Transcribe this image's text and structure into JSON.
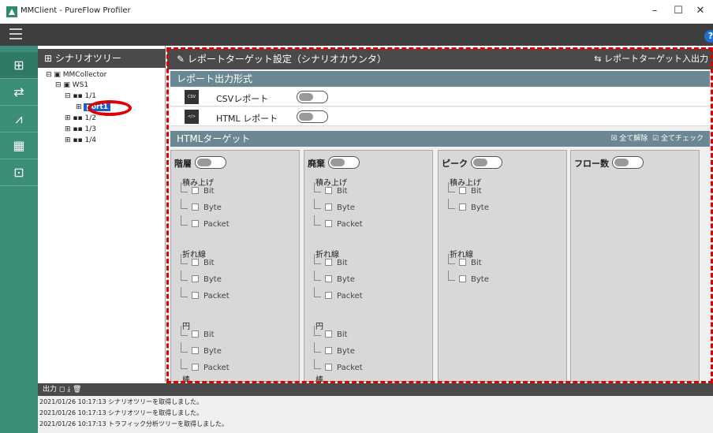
{
  "window": {
    "title": "MMClient - PureFlow Profiler",
    "min": "–",
    "max": "☐",
    "close": "✕"
  },
  "topbar": {
    "help": "?"
  },
  "sidebar": {
    "icons": [
      "tree-icon",
      "traffic-icon",
      "chart-icon",
      "report-icon",
      "grid-icon"
    ],
    "glyphs": [
      "⊞",
      "⇄",
      "⩘",
      "▦",
      "⊡"
    ]
  },
  "tree": {
    "header": "シナリオツリー",
    "nodes": [
      "MMCollector",
      "WS1",
      "1/1",
      "port1",
      "1/2",
      "1/3",
      "1/4"
    ]
  },
  "main": {
    "header": "レポートターゲット設定（シナリオカウンタ）",
    "io_link": "レポートターゲット入出力"
  },
  "report": {
    "section": "レポート出力形式",
    "csv_label": "CSVレポート",
    "html_label": "HTML レポート",
    "csv_icon": "CSV",
    "html_icon": "&lt;html&gt;"
  },
  "target": {
    "section": "HTMLターゲット",
    "clear_all": "全て解除",
    "check_all": "全てチェック"
  },
  "cards": [
    {
      "title": "階層",
      "groups": [
        {
          "name": "積み上げ",
          "items": [
            "Bit",
            "Byte",
            "Packet"
          ]
        },
        {
          "name": "折れ線",
          "items": [
            "Bit",
            "Byte",
            "Packet"
          ]
        },
        {
          "name": "円",
          "items": [
            "Bit",
            "Byte",
            "Packet"
          ]
        }
      ],
      "more": "棒"
    },
    {
      "title": "廃棄",
      "groups": [
        {
          "name": "積み上げ",
          "items": [
            "Bit",
            "Byte",
            "Packet"
          ]
        },
        {
          "name": "折れ線",
          "items": [
            "Bit",
            "Byte",
            "Packet"
          ]
        },
        {
          "name": "円",
          "items": [
            "Bit",
            "Byte",
            "Packet"
          ]
        }
      ],
      "more": "棒"
    },
    {
      "title": "ピーク",
      "groups": [
        {
          "name": "積み上げ",
          "items": [
            "Bit",
            "Byte"
          ]
        },
        {
          "name": "折れ線",
          "items": [
            "Bit",
            "Byte"
          ]
        }
      ],
      "more": ""
    },
    {
      "title": "フロー数",
      "groups": [],
      "more": ""
    }
  ],
  "output": {
    "label": "出力",
    "lines": [
      "2021/01/26 10:17:13 シナリオツリーを取得しました。",
      "2021/01/26 10:17:13 シナリオツリーを取得しました。",
      "2021/01/26 10:17:13 トラフィック分析ツリーを取得しました。"
    ]
  }
}
